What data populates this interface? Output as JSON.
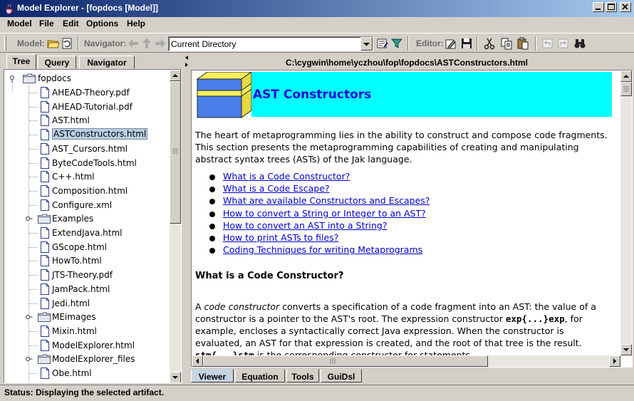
{
  "window": {
    "title": "Model Explorer - [fopdocs [Model]]"
  },
  "menu": [
    "Model",
    "File",
    "Edit",
    "Options",
    "Help"
  ],
  "toolbar": {
    "model_label": "Model:",
    "navigator_label": "Navigator:",
    "navigator_value": "Current Directory",
    "editor_label": "Editor:"
  },
  "left_tabs": [
    "Tree",
    "Query",
    "Navigator"
  ],
  "tree": {
    "root": "fopdocs",
    "items": [
      {
        "label": "AHEAD-Theory.pdf",
        "type": "file"
      },
      {
        "label": "AHEAD-Tutorial.pdf",
        "type": "file"
      },
      {
        "label": "AST.html",
        "type": "file"
      },
      {
        "label": "ASTConstructors.html",
        "type": "file",
        "selected": true
      },
      {
        "label": "AST_Cursors.html",
        "type": "file"
      },
      {
        "label": "ByteCodeTools.html",
        "type": "file"
      },
      {
        "label": "C++.html",
        "type": "file"
      },
      {
        "label": "Composition.html",
        "type": "file"
      },
      {
        "label": "Configure.xml",
        "type": "file"
      },
      {
        "label": "Examples",
        "type": "folder"
      },
      {
        "label": "ExtendJava.html",
        "type": "file"
      },
      {
        "label": "GScope.html",
        "type": "file"
      },
      {
        "label": "HowTo.html",
        "type": "file"
      },
      {
        "label": "JTS-Theory.pdf",
        "type": "file"
      },
      {
        "label": "JamPack.html",
        "type": "file"
      },
      {
        "label": "Jedi.html",
        "type": "file"
      },
      {
        "label": "MEimages",
        "type": "folder"
      },
      {
        "label": "Mixin.html",
        "type": "file"
      },
      {
        "label": "ModelExplorer.html",
        "type": "file"
      },
      {
        "label": "ModelExplorer_files",
        "type": "folder"
      },
      {
        "label": "Obe.html",
        "type": "file"
      }
    ]
  },
  "viewer": {
    "path": "C:\\cygwin\\home\\yczhou\\fop\\fopdocs\\ASTConstructors.html",
    "heading": "AST Constructors",
    "intro": "The heart of metaprogramming lies in the ability to construct and compose code fragments. This section presents the metaprogramming capabilities of creating and manipulating abstract syntax trees (ASTs) of the Jak language.",
    "links": [
      "What is a Code Constructor?",
      "What is a Code Escape?",
      "What are available Constructors and Escapes?",
      "How to convert a String or Integer to an AST?",
      "How to convert an AST into a String?",
      "How to print ASTs to files?",
      "Coding Techniques for writing Metaprograms"
    ],
    "section_heading": "What is a Code Constructor?",
    "section_p1": "A ",
    "section_em": "code constructor",
    "section_p2": " converts a specification of a code fragment into an AST: the value of a constructor is a pointer to the AST's root. The expression constructor ",
    "section_code1": "exp{...}exp",
    "section_p3": ", for example, encloses a syntactically correct Java expression. When the constructor is evaluated, an AST for that expression is created, and the root of that tree is the result. ",
    "section_code2": "stm{...}stm",
    "section_p4": " is the corresponding constructor for statements."
  },
  "bottom_tabs": [
    "Viewer",
    "Equation",
    "Tools",
    "GuiDsl"
  ],
  "status": "Status: Displaying the selected artifact."
}
